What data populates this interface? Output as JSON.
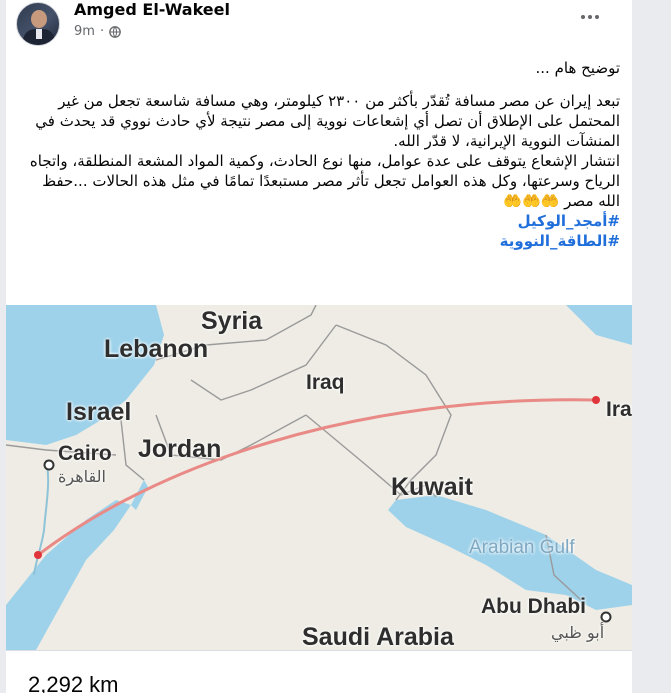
{
  "post": {
    "author": "Amged El-Wakeel",
    "time": "9m",
    "privacy_icon": "globe-icon",
    "more_icon": "more-options-icon",
    "text": {
      "heading": "توضيح هام ...",
      "paragraph1": "تبعد إيران عن مصر مسافة تُقدّر بأكثر من ٢٣٠٠ كيلومتر، وهي مسافة شاسعة تجعل من غير المحتمل على الإطلاق أن تصل أي إشعاعات نووية إلى مصر نتيجة لأي حادث نووي قد يحدث في المنشآت النووية الإيرانية، لا قدّر الله.",
      "paragraph2": "انتشار الإشعاع يتوقف على عدة عوامل، منها نوع الحادث، وكمية المواد المشعة المنطلقة، واتجاه الرياح وسرعتها، وكل هذه العوامل تجعل تأثر مصر مستبعدًا تمامًا في مثل هذه الحالات ...حفظ الله مصر 🤲🤲🤲",
      "hashtags": [
        "#أمجد_الوكيل",
        "#الطاقة_النووية"
      ]
    }
  },
  "map": {
    "labels": {
      "syria": "Syria",
      "lebanon": "Lebanon",
      "iraq": "Iraq",
      "israel": "Israel",
      "iran": "Iran",
      "cairo": "Cairo",
      "cairo_ar": "القاهرة",
      "jordan": "Jordan",
      "kuwait": "Kuwait",
      "arabian_gulf": "Arabian Gulf",
      "abu_dhabi": "Abu Dhabi",
      "abu_dhabi_ar": "أبو ظبي",
      "saudi_arabia": "Saudi Arabia"
    },
    "colors": {
      "land": "#eeece4",
      "water": "#9ed2ea",
      "route": "#e98a86",
      "route_point": "#e0353a",
      "border": "#9a9a9a"
    }
  },
  "distance": "2,292 km"
}
